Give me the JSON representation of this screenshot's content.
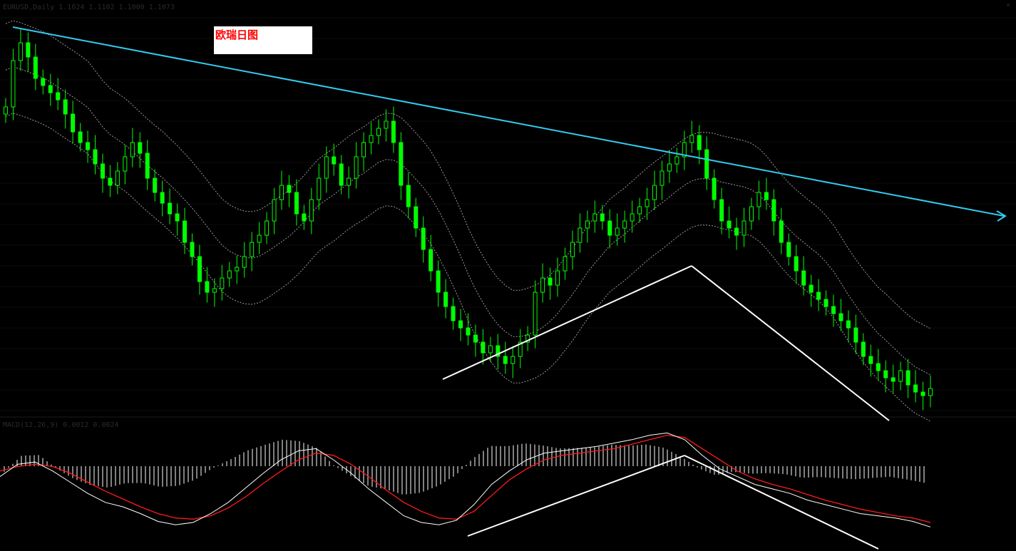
{
  "header": {
    "main_indicator": "EURUSD,Daily 1.1024 1.1102 1.1000 1.1073",
    "sub_indicator": "MACD(12,26,9) 0.0012 0.0024",
    "corner_mark": "×"
  },
  "annotation": {
    "label": "欧瑞日图"
  },
  "colors": {
    "background": "#000000",
    "candle": "#00ff00",
    "bollinger": "#9a9a9a",
    "trendline": "#33ccee",
    "white_lines": "#ffffff",
    "macd_line": "#ffffff",
    "signal_line": "#ff1a1a",
    "histogram": "#ffffff",
    "label_text": "#ff0000"
  },
  "chart_data": [
    {
      "type": "candlestick",
      "description_key": "main",
      "overlays": [
        "bollinger-bands",
        "downward-trendline",
        "two white trend segments"
      ],
      "close_series_relative": [
        0.82,
        0.95,
        1.0,
        0.96,
        0.9,
        0.88,
        0.86,
        0.84,
        0.8,
        0.75,
        0.72,
        0.7,
        0.66,
        0.62,
        0.6,
        0.64,
        0.68,
        0.72,
        0.69,
        0.62,
        0.58,
        0.55,
        0.52,
        0.5,
        0.44,
        0.4,
        0.33,
        0.3,
        0.31,
        0.34,
        0.36,
        0.37,
        0.4,
        0.44,
        0.46,
        0.5,
        0.56,
        0.6,
        0.58,
        0.52,
        0.5,
        0.56,
        0.62,
        0.68,
        0.66,
        0.6,
        0.62,
        0.68,
        0.72,
        0.74,
        0.76,
        0.78,
        0.72,
        0.6,
        0.54,
        0.48,
        0.42,
        0.36,
        0.3,
        0.26,
        0.22,
        0.2,
        0.18,
        0.16,
        0.13,
        0.15,
        0.12,
        0.1,
        0.12,
        0.16,
        0.18,
        0.3,
        0.34,
        0.32,
        0.36,
        0.4,
        0.44,
        0.48,
        0.5,
        0.52,
        0.5,
        0.46,
        0.48,
        0.5,
        0.52,
        0.54,
        0.56,
        0.6,
        0.64,
        0.66,
        0.68,
        0.72,
        0.74,
        0.7,
        0.62,
        0.56,
        0.5,
        0.48,
        0.46,
        0.5,
        0.54,
        0.58,
        0.56,
        0.5,
        0.44,
        0.4,
        0.36,
        0.32,
        0.3,
        0.28,
        0.26,
        0.24,
        0.22,
        0.2,
        0.16,
        0.12,
        0.1,
        0.08,
        0.06,
        0.05,
        0.08,
        0.04,
        0.02,
        0.01,
        0.03
      ]
    },
    {
      "type": "macd",
      "description_key": "sub",
      "series": [
        {
          "name": "MACD",
          "values_relative": [
            0.55,
            0.66,
            0.68,
            0.6,
            0.5,
            0.4,
            0.32,
            0.28,
            0.22,
            0.15,
            0.12,
            0.14,
            0.22,
            0.32,
            0.45,
            0.58,
            0.7,
            0.78,
            0.8,
            0.7,
            0.58,
            0.44,
            0.32,
            0.2,
            0.14,
            0.12,
            0.16,
            0.3,
            0.48,
            0.6,
            0.7,
            0.76,
            0.78,
            0.8,
            0.82,
            0.85,
            0.88,
            0.92,
            0.94,
            0.88,
            0.74,
            0.62,
            0.55,
            0.48,
            0.44,
            0.4,
            0.34,
            0.3,
            0.26,
            0.22,
            0.2,
            0.18,
            0.15,
            0.1
          ]
        },
        {
          "name": "Signal",
          "values_relative": [
            0.6,
            0.64,
            0.66,
            0.64,
            0.58,
            0.5,
            0.42,
            0.35,
            0.28,
            0.22,
            0.18,
            0.17,
            0.2,
            0.27,
            0.37,
            0.49,
            0.6,
            0.7,
            0.76,
            0.74,
            0.66,
            0.55,
            0.43,
            0.32,
            0.24,
            0.18,
            0.17,
            0.24,
            0.38,
            0.52,
            0.62,
            0.7,
            0.74,
            0.76,
            0.78,
            0.8,
            0.84,
            0.88,
            0.92,
            0.9,
            0.8,
            0.7,
            0.6,
            0.53,
            0.48,
            0.44,
            0.39,
            0.34,
            0.3,
            0.26,
            0.23,
            0.2,
            0.18,
            0.14
          ]
        }
      ]
    }
  ]
}
